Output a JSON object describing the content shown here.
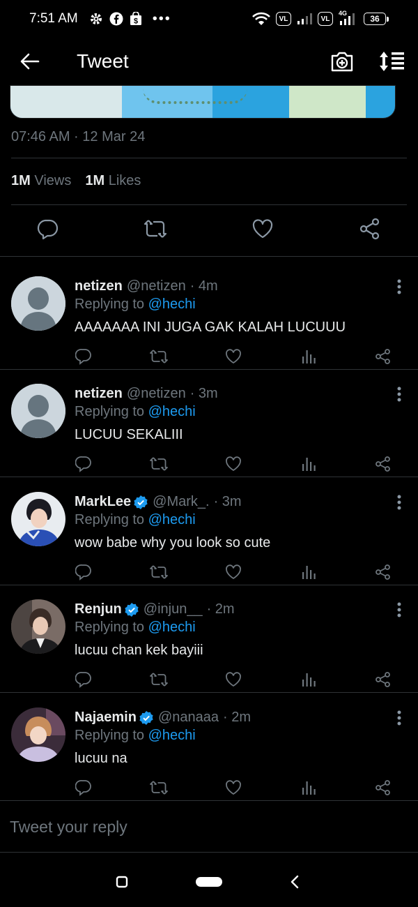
{
  "status": {
    "time": "7:51 AM",
    "volte1": "VL",
    "volte2": "VL",
    "net": "4G",
    "battery": "36"
  },
  "header": {
    "title": "Tweet"
  },
  "tweet": {
    "timestamp": "07:46 AM · 12 Mar 24",
    "views_count": "1M",
    "views_label": "Views",
    "likes_count": "1M",
    "likes_label": "Likes"
  },
  "replies": [
    {
      "name": "netizen",
      "handle": "@netizen",
      "time": "· 4m",
      "verified": false,
      "replying_prefix": "Replying to",
      "replying_to": "@hechi",
      "text": "AAAAAAA INI JUGA GAK KALAH LUCUUU"
    },
    {
      "name": "netizen",
      "handle": "@netizen",
      "time": "· 3m",
      "verified": false,
      "replying_prefix": "Replying to",
      "replying_to": "@hechi",
      "text": "LUCUU SEKALIII"
    },
    {
      "name": "MarkLee",
      "handle": "@Mark_.",
      "time": "· 3m",
      "verified": true,
      "replying_prefix": "Replying to",
      "replying_to": "@hechi",
      "text": "wow babe why you look so cute"
    },
    {
      "name": "Renjun",
      "handle": "@injun__",
      "time": "· 2m",
      "verified": true,
      "replying_prefix": "Replying to",
      "replying_to": "@hechi",
      "text": "lucuu chan kek bayiii"
    },
    {
      "name": "Najaemin",
      "handle": "@nanaaa",
      "time": "· 2m",
      "verified": true,
      "replying_prefix": "Replying to",
      "replying_to": "@hechi",
      "text": "lucuu na"
    }
  ],
  "composer": {
    "placeholder": "Tweet your reply"
  },
  "colors": {
    "background": "#000000",
    "accent": "#1d9bf0",
    "muted": "#6e767d",
    "text": "#e7e9ea"
  },
  "icons": [
    "back-arrow-icon",
    "camera-plus-icon",
    "sort-icon",
    "comment-icon",
    "retweet-icon",
    "heart-icon",
    "share-icon",
    "analytics-icon",
    "more-icon",
    "verified-icon"
  ]
}
